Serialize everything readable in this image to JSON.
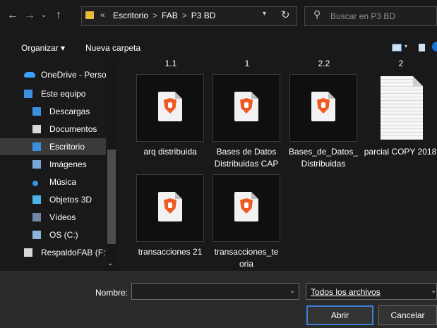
{
  "address_bar": {
    "path_overflow": "«",
    "path": [
      "Escritorio",
      "FAB",
      "P3 BD"
    ],
    "separator": ">",
    "search_placeholder": "Buscar en P3 BD"
  },
  "toolbar": {
    "organize_label": "Organizar ▾",
    "new_folder_label": "Nueva carpeta"
  },
  "nav": {
    "items": [
      {
        "label": "OneDrive - Person",
        "icon": "cloud-icon",
        "color": "#3aa0ff"
      },
      {
        "label": "Este equipo",
        "icon": "computer-icon",
        "color": "#3d8fe0"
      },
      {
        "label": "Descargas",
        "icon": "download-icon",
        "color": "#3d8fe0"
      },
      {
        "label": "Documentos",
        "icon": "documents-icon",
        "color": "#d8d8d8"
      },
      {
        "label": "Escritorio",
        "icon": "desktop-icon",
        "color": "#3d8fe0",
        "selected": true
      },
      {
        "label": "Imágenes",
        "icon": "images-icon",
        "color": "#7aa8d8"
      },
      {
        "label": "Música",
        "icon": "music-icon",
        "color": "#3d8fe0"
      },
      {
        "label": "Objetos 3D",
        "icon": "cube-icon",
        "color": "#4fb3e8"
      },
      {
        "label": "Vídeos",
        "icon": "videos-icon",
        "color": "#6f88a6"
      },
      {
        "label": "OS (C:)",
        "icon": "drive-icon",
        "color": "#8fb4d9"
      },
      {
        "label": "RespaldoFAB (F:)",
        "icon": "usb-drive-icon",
        "color": "#d8d8d8"
      }
    ]
  },
  "content": {
    "top_labels": [
      "1.1",
      "1",
      "2.2",
      "2"
    ],
    "files": [
      {
        "name": "arq distribuida",
        "type": "brave-pdf"
      },
      {
        "name": "Bases de Datos Distribuidas CAP",
        "type": "brave-pdf"
      },
      {
        "name": "Bases_de_Datos_ Distribuidas",
        "type": "brave-pdf"
      },
      {
        "name": "parcial COPY 2018",
        "type": "document"
      },
      {
        "name": "transacciones 21",
        "type": "brave-pdf"
      },
      {
        "name": "transacciones_te oria",
        "type": "brave-pdf"
      }
    ]
  },
  "bottom": {
    "name_label": "Nombre:",
    "name_value": "",
    "filter_label": "Todos los archivos",
    "open_label": "Abrir",
    "cancel_label": "Cancelar"
  },
  "colors": {
    "accent": "#3c80d4",
    "brave": "#ef5a24",
    "selected_bg": "#3a3a3a"
  }
}
